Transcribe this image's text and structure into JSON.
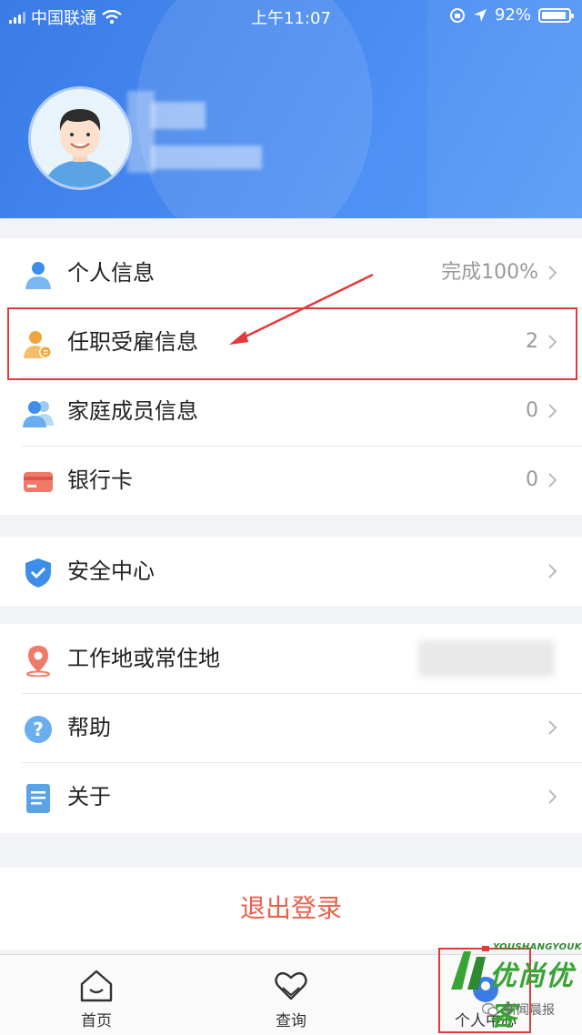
{
  "status_bar": {
    "carrier": "中国联通",
    "time": "上午11:07",
    "battery": "92%"
  },
  "profile": {
    "avatar": "avatar"
  },
  "menu_group_1": [
    {
      "icon": "person-icon",
      "label": "个人信息",
      "value": "完成100%"
    },
    {
      "icon": "employment-icon",
      "label": "任职受雇信息",
      "value": "2"
    },
    {
      "icon": "family-icon",
      "label": "家庭成员信息",
      "value": "0"
    },
    {
      "icon": "bank-card-icon",
      "label": "银行卡",
      "value": "0"
    }
  ],
  "menu_group_2": [
    {
      "icon": "shield-icon",
      "label": "安全中心",
      "value": ""
    }
  ],
  "menu_group_3": [
    {
      "icon": "location-pin-icon",
      "label": "工作地或常住地",
      "value": ""
    },
    {
      "icon": "help-icon",
      "label": "帮助",
      "value": ""
    },
    {
      "icon": "document-icon",
      "label": "关于",
      "value": ""
    }
  ],
  "logout_label": "退出登录",
  "tabbar": {
    "home": "首页",
    "query": "查询",
    "profile": "个人中心"
  },
  "watermark": {
    "brand_en": "YOUSHANGYOUKE",
    "brand_cn": "优尚优客",
    "source": "新闻晨报"
  },
  "colors": {
    "header": "#4a8cf2",
    "highlight": "#e23a3a",
    "logout": "#e8604c"
  }
}
